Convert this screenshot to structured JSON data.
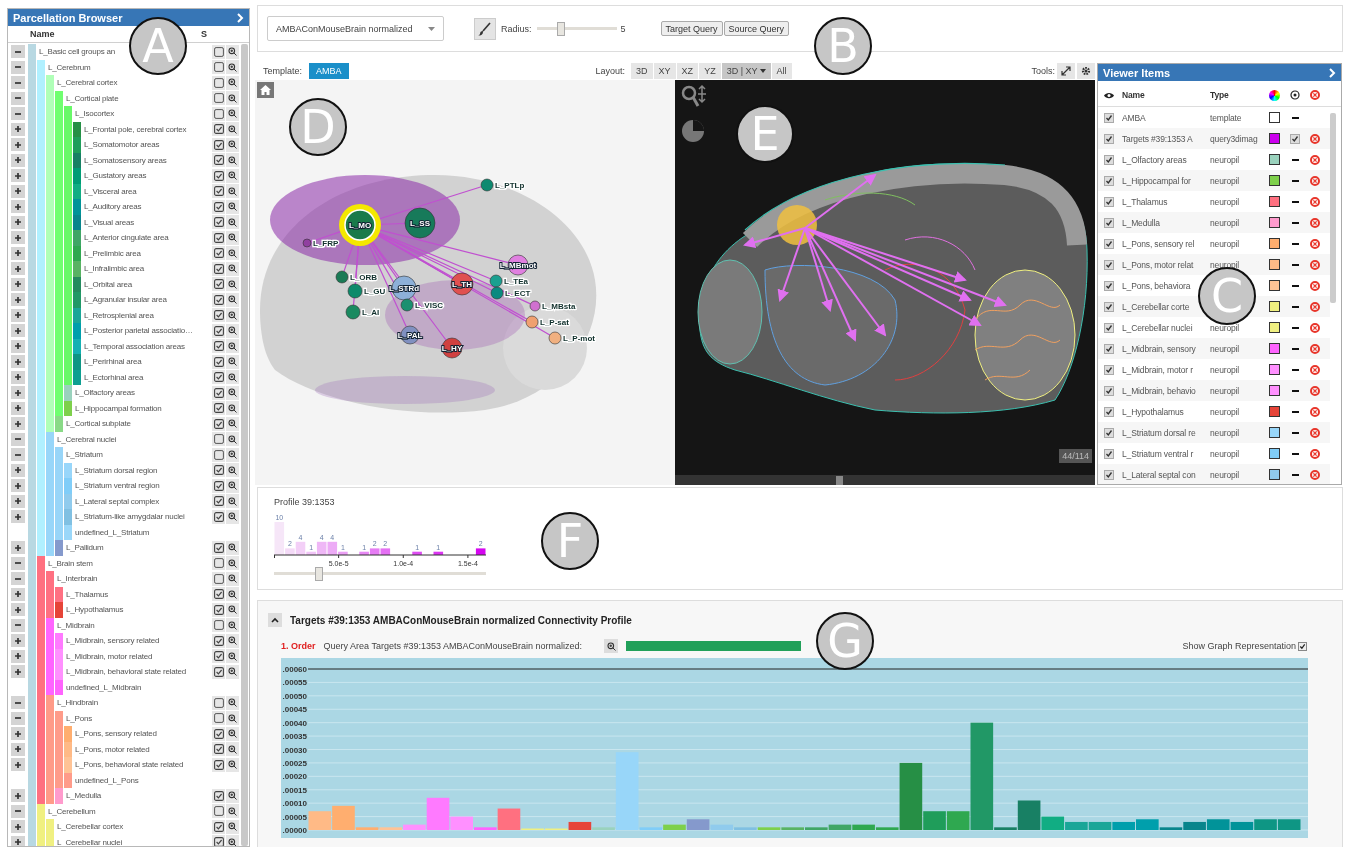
{
  "parcellation_browser": {
    "title": "Parcellation Browser",
    "columns": [
      "Name",
      "S"
    ],
    "items": [
      {
        "label": "L_Basic cell groups an",
        "kind": "region",
        "expanded": true,
        "checked": false,
        "color": "#b8d8e2",
        "children": [
          {
            "label": "L_Cerebrum",
            "kind": "region",
            "expanded": true,
            "checked": false,
            "color": "#b0f0ff",
            "children": [
              {
                "label": "L_Cerebral cortex",
                "kind": "region",
                "expanded": true,
                "checked": false,
                "color": "#b0ffb8",
                "children": [
                  {
                    "label": "L_Cortical plate",
                    "kind": "region",
                    "expanded": true,
                    "checked": false,
                    "color": "#70ff70",
                    "children": [
                      {
                        "label": "L_Isocortex",
                        "kind": "region",
                        "expanded": true,
                        "checked": false,
                        "color": "#68f868",
                        "children": [
                          {
                            "label": "L_Frontal pole, cerebral cortex",
                            "kind": "region",
                            "expanded": false,
                            "checked": true,
                            "color": "#268f45"
                          },
                          {
                            "label": "L_Somatomotor areas",
                            "kind": "region",
                            "expanded": false,
                            "checked": true,
                            "color": "#1f9d5a"
                          },
                          {
                            "label": "L_Somatosensory areas",
                            "kind": "region",
                            "expanded": false,
                            "checked": true,
                            "color": "#188064"
                          },
                          {
                            "label": "L_Gustatory areas",
                            "kind": "region",
                            "expanded": false,
                            "checked": true,
                            "color": "#009c75"
                          },
                          {
                            "label": "L_Visceral area",
                            "kind": "region",
                            "expanded": false,
                            "checked": true,
                            "color": "#11ad83"
                          },
                          {
                            "label": "L_Auditory areas",
                            "kind": "region",
                            "expanded": false,
                            "checked": true,
                            "color": "#019399"
                          },
                          {
                            "label": "L_Visual areas",
                            "kind": "region",
                            "expanded": false,
                            "checked": true,
                            "color": "#08858c"
                          },
                          {
                            "label": "L_Anterior cingulate area",
                            "kind": "region",
                            "expanded": false,
                            "checked": true,
                            "color": "#40a666"
                          },
                          {
                            "label": "L_Prelimbic area",
                            "kind": "region",
                            "expanded": false,
                            "checked": true,
                            "color": "#2fa850"
                          },
                          {
                            "label": "L_Infralimbic area",
                            "kind": "region",
                            "expanded": false,
                            "checked": true,
                            "color": "#59b363"
                          },
                          {
                            "label": "L_Orbital area",
                            "kind": "region",
                            "expanded": false,
                            "checked": true,
                            "color": "#248a5e"
                          },
                          {
                            "label": "L_Agranular insular area",
                            "kind": "region",
                            "expanded": false,
                            "checked": true,
                            "color": "#219866"
                          },
                          {
                            "label": "L_Retrosplenial area",
                            "kind": "region",
                            "expanded": false,
                            "checked": true,
                            "color": "#1aa698"
                          },
                          {
                            "label": "L_Posterior parietal associatio…",
                            "kind": "region",
                            "expanded": false,
                            "checked": true,
                            "color": "#009fac"
                          },
                          {
                            "label": "L_Temporal association areas",
                            "kind": "region",
                            "expanded": false,
                            "checked": true,
                            "color": "#15b0b3"
                          },
                          {
                            "label": "L_Perirhinal area",
                            "kind": "region",
                            "expanded": false,
                            "checked": true,
                            "color": "#0e9684"
                          },
                          {
                            "label": "L_Ectorhinal area",
                            "kind": "region",
                            "expanded": false,
                            "checked": true,
                            "color": "#0d9f91"
                          }
                        ]
                      },
                      {
                        "label": "L_Olfactory areas",
                        "kind": "region",
                        "expanded": false,
                        "checked": true,
                        "color": "#9ad2bd"
                      },
                      {
                        "label": "L_Hippocampal formation",
                        "kind": "region",
                        "expanded": false,
                        "checked": true,
                        "color": "#7ed04b"
                      }
                    ]
                  },
                  {
                    "label": "L_Cortical subplate",
                    "kind": "region",
                    "expanded": false,
                    "checked": true,
                    "color": "#8ada87"
                  }
                ]
              },
              {
                "label": "L_Cerebral nuclei",
                "kind": "region",
                "expanded": true,
                "checked": false,
                "color": "#98d6f9",
                "children": [
                  {
                    "label": "L_Striatum",
                    "kind": "region",
                    "expanded": true,
                    "checked": false,
                    "color": "#98d5f8",
                    "children": [
                      {
                        "label": "L_Striatum dorsal region",
                        "kind": "region",
                        "expanded": false,
                        "checked": true,
                        "color": "#98d6fa"
                      },
                      {
                        "label": "L_Striatum ventral region",
                        "kind": "region",
                        "expanded": false,
                        "checked": true,
                        "color": "#80cdf8"
                      },
                      {
                        "label": "L_Lateral septal complex",
                        "kind": "region",
                        "expanded": false,
                        "checked": true,
                        "color": "#90cbed"
                      },
                      {
                        "label": "L_Striatum-like amygdalar nuclei",
                        "kind": "region",
                        "expanded": false,
                        "checked": true,
                        "color": "#80c0e2"
                      },
                      {
                        "label": "undefined_L_Striatum",
                        "kind": "placeholder",
                        "color": "#9ad7f9"
                      }
                    ]
                  },
                  {
                    "label": "L_Pallidum",
                    "kind": "region",
                    "expanded": false,
                    "checked": true,
                    "color": "#8599cc"
                  }
                ]
              }
            ]
          },
          {
            "label": "L_Brain stem",
            "kind": "region",
            "expanded": true,
            "checked": false,
            "color": "#ff7080",
            "children": [
              {
                "label": "L_Interbrain",
                "kind": "region",
                "expanded": true,
                "checked": false,
                "color": "#ff7081",
                "children": [
                  {
                    "label": "L_Thalamus",
                    "kind": "region",
                    "expanded": false,
                    "checked": true,
                    "color": "#ff7082"
                  },
                  {
                    "label": "L_Hypothalamus",
                    "kind": "region",
                    "expanded": false,
                    "checked": true,
                    "color": "#e64438"
                  }
                ]
              },
              {
                "label": "L_Midbrain",
                "kind": "region",
                "expanded": true,
                "checked": false,
                "color": "#ff64ff",
                "children": [
                  {
                    "label": "L_Midbrain, sensory related",
                    "kind": "region",
                    "expanded": false,
                    "checked": true,
                    "color": "#ff7aff"
                  },
                  {
                    "label": "L_Midbrain, motor related",
                    "kind": "region",
                    "expanded": false,
                    "checked": true,
                    "color": "#ff90ff"
                  },
                  {
                    "label": "L_Midbrain, behavioral state related",
                    "kind": "region",
                    "expanded": false,
                    "checked": true,
                    "color": "#ff90fe"
                  },
                  {
                    "label": "undefined_L_Midbrain",
                    "kind": "placeholder",
                    "color": "#ff64fe"
                  }
                ]
              },
              {
                "label": "L_Hindbrain",
                "kind": "region",
                "expanded": true,
                "checked": false,
                "color": "#ff9b88",
                "children": [
                  {
                    "label": "L_Pons",
                    "kind": "region",
                    "expanded": true,
                    "checked": false,
                    "color": "#ff9b89",
                    "children": [
                      {
                        "label": "L_Pons, sensory related",
                        "kind": "region",
                        "expanded": false,
                        "checked": true,
                        "color": "#ffae6f"
                      },
                      {
                        "label": "L_Pons, motor related",
                        "kind": "region",
                        "expanded": false,
                        "checked": true,
                        "color": "#ffba86"
                      },
                      {
                        "label": "L_Pons, behavioral state related",
                        "kind": "region",
                        "expanded": false,
                        "checked": true,
                        "color": "#ffc395"
                      },
                      {
                        "label": "undefined_L_Pons",
                        "kind": "placeholder",
                        "color": "#ff9b8a"
                      }
                    ]
                  },
                  {
                    "label": "L_Medulla",
                    "kind": "region",
                    "expanded": false,
                    "checked": true,
                    "color": "#ff9bcd"
                  }
                ]
              }
            ]
          },
          {
            "label": "L_Cerebellum",
            "kind": "region",
            "expanded": true,
            "checked": false,
            "color": "#f0f080",
            "children": [
              {
                "label": "L_Cerebellar cortex",
                "kind": "region",
                "expanded": false,
                "checked": true,
                "color": "#f0f081"
              },
              {
                "label": "L_Cerebellar nuclei",
                "kind": "region",
                "expanded": false,
                "checked": true,
                "color": "#f0f082"
              }
            ]
          }
        ]
      }
    ]
  },
  "toolbar": {
    "dataset": "AMBAConMouseBrain normalized",
    "radius_label": "Radius:",
    "radius": {
      "level": 0.31
    },
    "radius_value": "5",
    "buttons": [
      "Target Query",
      "Source Query"
    ]
  },
  "view_bar": {
    "template_label": "Template:",
    "template": "AMBA",
    "layout_label": "Layout:",
    "layouts": [
      {
        "label": "3D",
        "kind": "button",
        "selected": false
      },
      {
        "label": "XY",
        "kind": "button",
        "selected": false
      },
      {
        "label": "XZ",
        "kind": "button",
        "selected": false
      },
      {
        "label": "YZ",
        "kind": "button",
        "selected": false
      },
      {
        "label": "3D | XY",
        "kind": "dropdown",
        "selected": true
      },
      {
        "label": "All",
        "kind": "button",
        "selected": false
      }
    ],
    "tools_label": "Tools:"
  },
  "graph_view": {
    "nodes": [
      {
        "label": "L_PTLp",
        "color": "#0d8a70",
        "selected": false
      },
      {
        "label": "L_MO",
        "color": "#1a7a4a",
        "selected": true
      },
      {
        "label": "L_SS",
        "color": "#177a5a",
        "selected": false
      },
      {
        "label": "L_FRP",
        "color": "#9040a0",
        "selected": false
      },
      {
        "label": "L_ORB",
        "color": "#1a7a55",
        "selected": false
      },
      {
        "label": "L_GU",
        "color": "#0d8a6a",
        "selected": false
      },
      {
        "label": "L_AI",
        "color": "#1a8a60",
        "selected": false
      },
      {
        "label": "L_STRd",
        "color": "#8db0d8",
        "selected": false
      },
      {
        "label": "L_VISC",
        "color": "#1a9070",
        "selected": false
      },
      {
        "label": "L_TH",
        "color": "#e05050",
        "selected": false
      },
      {
        "label": "L_MBmot",
        "color": "#e080e0",
        "selected": false
      },
      {
        "label": "L_TEa",
        "color": "#1aa090",
        "selected": false
      },
      {
        "label": "L_ECT",
        "color": "#0a8a80",
        "selected": false
      },
      {
        "label": "L_MBsta",
        "color": "#d070d0",
        "selected": false
      },
      {
        "label": "L_P-sat",
        "color": "#f0a070",
        "selected": false
      },
      {
        "label": "L_P-mot",
        "color": "#f0b080",
        "selected": false
      },
      {
        "label": "L_PAL",
        "color": "#8090c0",
        "selected": false
      },
      {
        "label": "L_HY",
        "color": "#d04040",
        "selected": false
      }
    ]
  },
  "slice_view": {
    "slice": {
      "level": 0.39
    },
    "counter": "44/114"
  },
  "viewer_items": {
    "title": "Viewer Items",
    "columns": [
      "Name",
      "Type"
    ],
    "rows": [
      {
        "name": "AMBA",
        "type": "template",
        "kind": "template",
        "visible": true,
        "color": "#ffffff"
      },
      {
        "name": "Targets #39:1353 A",
        "type": "query3dimag",
        "kind": "query",
        "visible": true,
        "color": "#cc00ee",
        "checked": true
      },
      {
        "name": "L_Olfactory areas",
        "type": "neuropil",
        "kind": "region",
        "visible": true,
        "color": "#9ad2bd"
      },
      {
        "name": "L_Hippocampal for",
        "type": "neuropil",
        "kind": "region",
        "visible": true,
        "color": "#7ed04b"
      },
      {
        "name": "L_Thalamus",
        "type": "neuropil",
        "kind": "region",
        "visible": true,
        "color": "#ff7080"
      },
      {
        "name": "L_Medulla",
        "type": "neuropil",
        "kind": "region",
        "visible": true,
        "color": "#ff9bcd"
      },
      {
        "name": "L_Pons, sensory rel",
        "type": "neuropil",
        "kind": "region",
        "visible": true,
        "color": "#ffae6f"
      },
      {
        "name": "L_Pons, motor relat",
        "type": "neuropil",
        "kind": "region",
        "visible": true,
        "color": "#ffba86"
      },
      {
        "name": "L_Pons, behaviora",
        "kind": "region",
        "visible": true,
        "color": "#ffc395"
      },
      {
        "name": "L_Cerebellar corte",
        "kind": "region",
        "visible": true,
        "color": "#f0f080"
      },
      {
        "name": "L_Cerebellar nuclei",
        "type": "neuropil",
        "kind": "region",
        "visible": true,
        "color": "#f0f081"
      },
      {
        "name": "L_Midbrain, sensory",
        "type": "neuropil",
        "kind": "region",
        "visible": true,
        "color": "#ff64ff"
      },
      {
        "name": "L_Midbrain, motor r",
        "type": "neuropil",
        "kind": "region",
        "visible": true,
        "color": "#ff90ff"
      },
      {
        "name": "L_Midbrain, behavio",
        "type": "neuropil",
        "kind": "region",
        "visible": true,
        "color": "#ff90fe"
      },
      {
        "name": "L_Hypothalamus",
        "type": "neuropil",
        "kind": "region",
        "visible": true,
        "color": "#e64438"
      },
      {
        "name": "L_Striatum dorsal re",
        "type": "neuropil",
        "kind": "region",
        "visible": true,
        "color": "#98d6f9"
      },
      {
        "name": "L_Striatum ventral r",
        "type": "neuropil",
        "kind": "region",
        "visible": true,
        "color": "#80cdf8"
      },
      {
        "name": "L_Lateral septal con",
        "type": "neuropil",
        "kind": "region",
        "visible": true,
        "color": "#90cbed"
      }
    ]
  },
  "profile": {
    "title": "Profile 39:1353",
    "chart_data": {
      "type": "bar",
      "x": [
        4.1e-06,
        1.23e-05,
        2.05e-05,
        2.87e-05,
        3.69e-05,
        4.51e-05,
        5.33e-05,
        6.97e-05,
        7.79e-05,
        8.61e-05,
        0.0001107,
        0.0001271,
        0.0001599
      ],
      "values": [
        10,
        2,
        4,
        1,
        4,
        4,
        1,
        1,
        2,
        2,
        1,
        1,
        2
      ],
      "data_labels": true,
      "xlim": [
        0,
        0.000164
      ],
      "xticks": [
        {
          "value": 5e-05,
          "label": "5.0e-5"
        },
        {
          "value": 0.0001,
          "label": "1.0e-4"
        },
        {
          "value": 0.00015,
          "label": "1.5e-4"
        }
      ]
    },
    "threshold": {
      "level": 0.21
    }
  },
  "connectivity": {
    "title": "Targets #39:1353 AMBAConMouseBrain normalized Connectivity Profile",
    "expanded": true,
    "order": "1. Order",
    "query_label": "Query Area Targets #39:1353 AMBAConMouseBrain normalized:",
    "graph_toggle": {
      "label": "Show Graph Representation",
      "checked": true
    },
    "chart_data": {
      "type": "bar",
      "grid": true,
      "ylim": [
        0,
        0.0006
      ],
      "yticks": [
        {
          "value": 0,
          "label": ".00000"
        },
        {
          "value": 5e-05,
          "label": ".00005"
        },
        {
          "value": 0.0001,
          "label": ".00010"
        },
        {
          "value": 0.00015,
          "label": ".00015"
        },
        {
          "value": 0.0002,
          "label": ".00020"
        },
        {
          "value": 0.00025,
          "label": ".00025"
        },
        {
          "value": 0.0003,
          "label": ".00030"
        },
        {
          "value": 0.00035,
          "label": ".00035"
        },
        {
          "value": 0.0004,
          "label": ".00040"
        },
        {
          "value": 0.00045,
          "label": ".00045"
        },
        {
          "value": 0.0005,
          "label": ".00050"
        },
        {
          "value": 0.00055,
          "label": ".00055"
        },
        {
          "value": 0.0006,
          "label": ".00060"
        }
      ],
      "values": [
        7e-05,
        9e-05,
        1e-05,
        1e-05,
        2e-05,
        0.00012,
        5e-05,
        1e-05,
        8e-05,
        0,
        0,
        3e-05,
        1e-05,
        0.00029,
        1e-05,
        2e-05,
        4e-05,
        2e-05,
        1e-05,
        1e-05,
        1e-05,
        1e-05,
        2e-05,
        2e-05,
        1e-05,
        0.00025,
        7e-05,
        7e-05,
        0.0004,
        1e-05,
        0.00011,
        5e-05,
        3e-05,
        3e-05,
        3e-05,
        4e-05,
        1e-05,
        3e-05,
        4e-05,
        3e-05,
        4e-05,
        4e-05
      ],
      "colors": [
        "#ffba86",
        "#ffae6f",
        "#ffae6f",
        "#ffc395",
        "#ff90ff",
        "#ff7aff",
        "#ff90ff",
        "#ff64ff",
        "#ff7080",
        "#f0f080",
        "#f0f080",
        "#e64438",
        "#9ad2bd",
        "#98d6f9",
        "#80cdf8",
        "#7ed04b",
        "#8599cc",
        "#90cbed",
        "#80c0e2",
        "#7ed04b",
        "#59b363",
        "#40a666",
        "#40a666",
        "#2fa850",
        "#2fa850",
        "#268f45",
        "#1f9d5a",
        "#2fa850",
        "#219866",
        "#188064",
        "#188064",
        "#11ad83",
        "#1aa698",
        "#1aa698",
        "#009fac",
        "#009fac",
        "#08858c",
        "#08858c",
        "#019399",
        "#019399",
        "#0e9684",
        "#0e9684"
      ]
    }
  },
  "annotations": [
    "A",
    "B",
    "C",
    "D",
    "E",
    "F",
    "G"
  ]
}
